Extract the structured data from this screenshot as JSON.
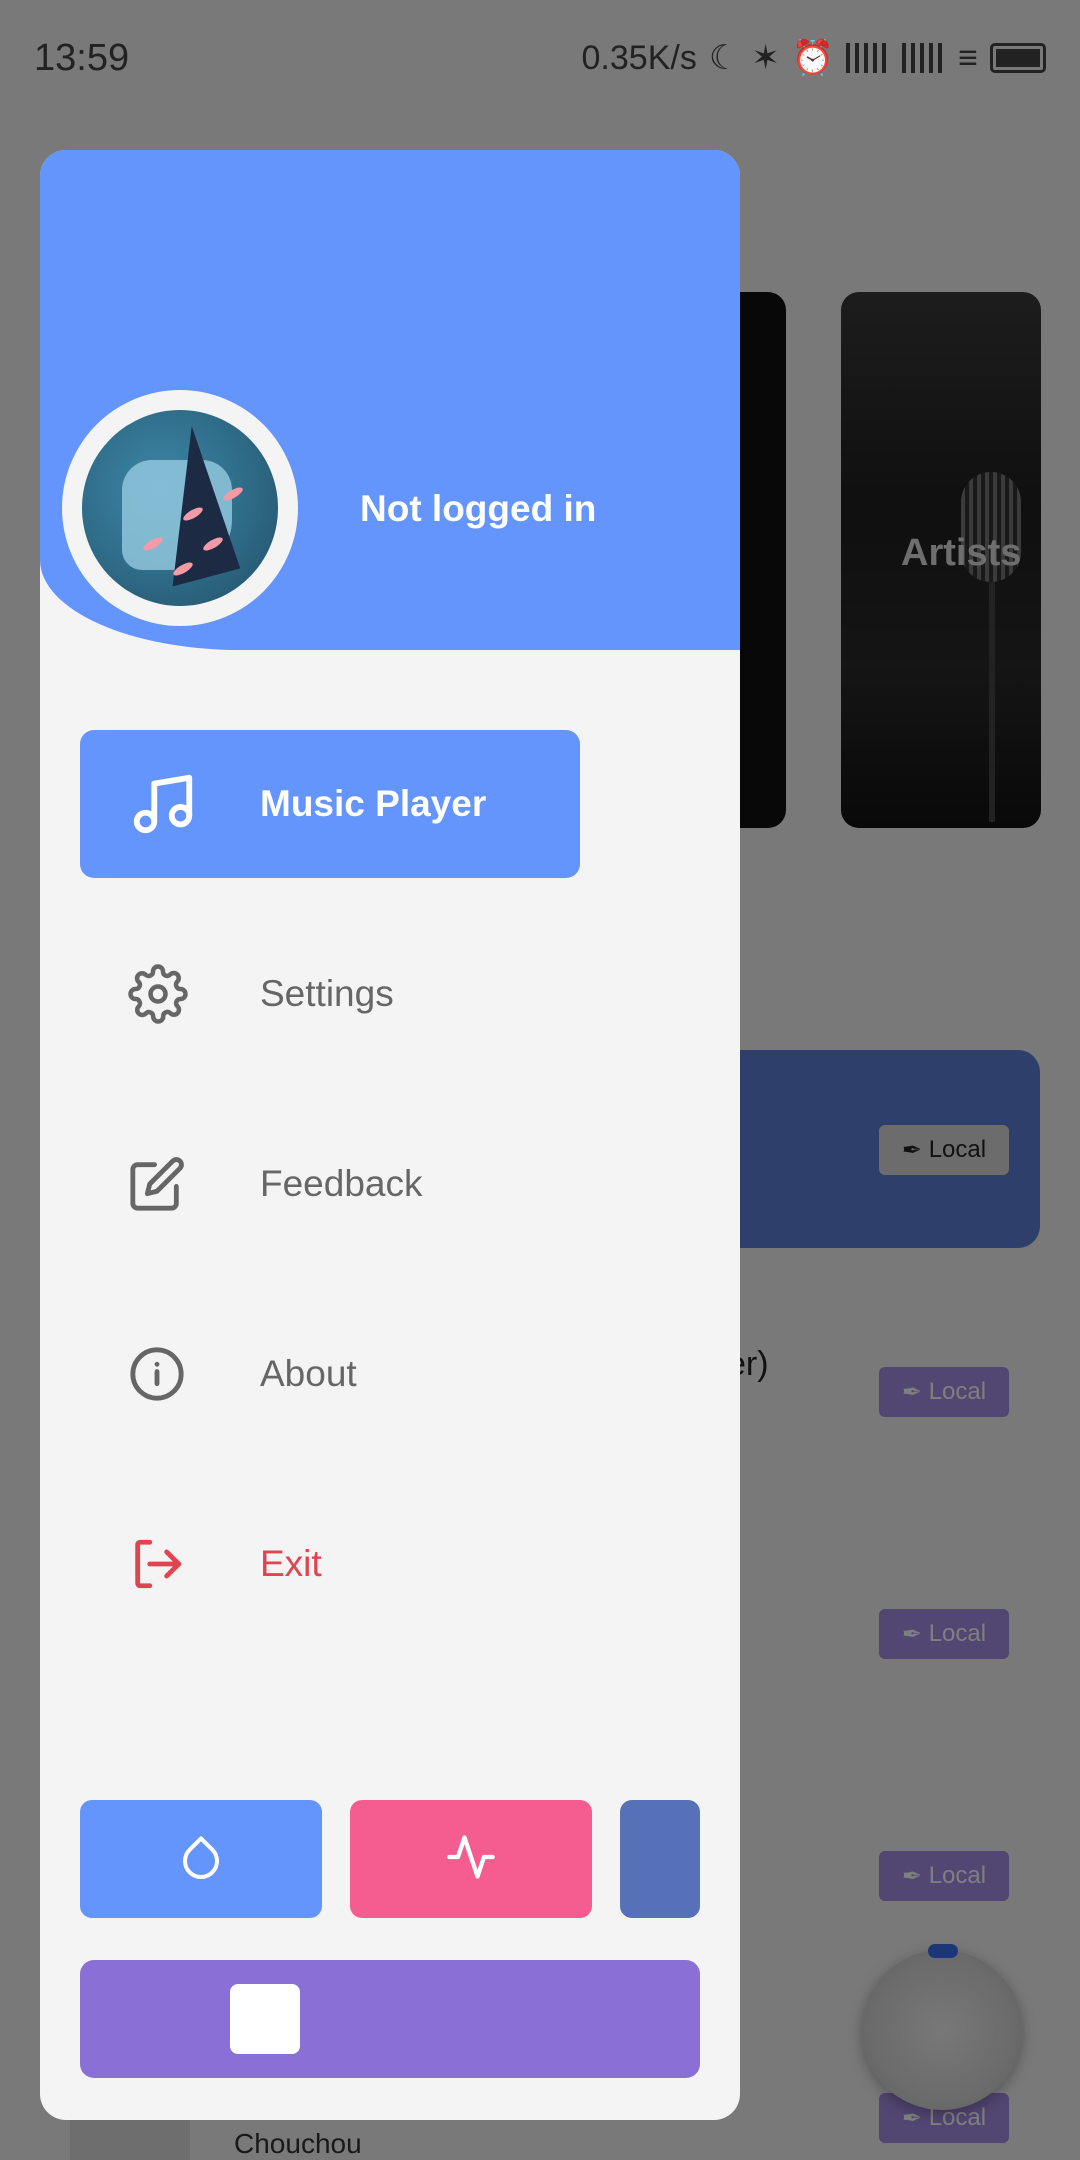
{
  "status_bar": {
    "time": "13:59",
    "network_speed": "0.35K/s"
  },
  "background": {
    "artists_label": "Artists",
    "local_badge": "Local",
    "partial_text": "yer)",
    "bottom_text": "Chouchou"
  },
  "drawer": {
    "user_status": "Not logged in",
    "menu": [
      {
        "label": "Music Player",
        "icon": "music-note-icon",
        "active": true
      },
      {
        "label": "Settings",
        "icon": "gear-icon",
        "active": false
      },
      {
        "label": "Feedback",
        "icon": "edit-icon",
        "active": false
      },
      {
        "label": "About",
        "icon": "info-icon",
        "active": false
      },
      {
        "label": "Exit",
        "icon": "logout-icon",
        "active": false
      }
    ],
    "theme_buttons": [
      {
        "icon": "droplet-icon",
        "color": "#6495fc"
      },
      {
        "icon": "pulse-icon",
        "color": "#f55d91"
      },
      {
        "icon": "",
        "color": "#5671b8"
      }
    ],
    "wide_button_color": "#8a6fd6",
    "accent_color": "#6495fc",
    "exit_color": "#e0454f"
  }
}
